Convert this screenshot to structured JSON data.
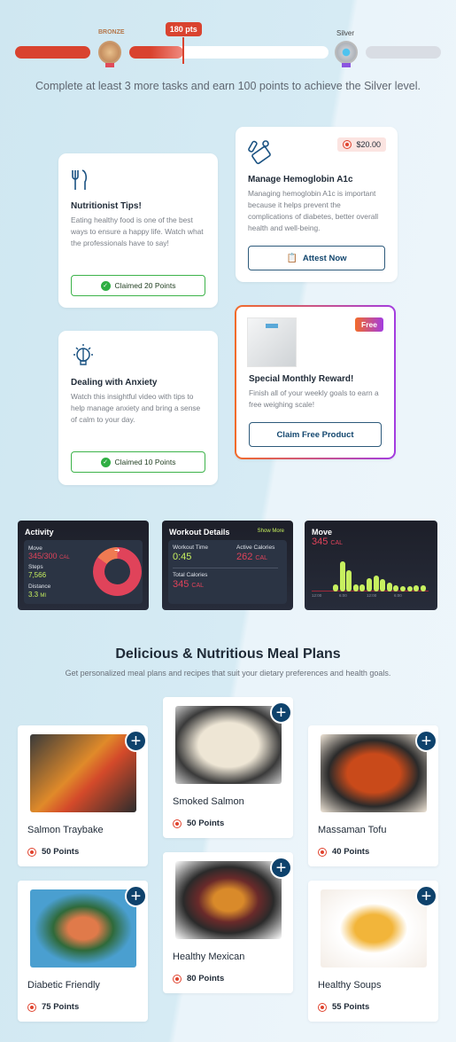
{
  "progress": {
    "current_points": "180 pts",
    "levels": [
      {
        "label": "BRONZE",
        "color": "#b5774b"
      },
      {
        "label": "Silver",
        "color": "#9aa0a8"
      }
    ],
    "fill_fraction": 0.27,
    "message": "Complete at least 3 more tasks and earn 100 points to achieve the Silver level.",
    "accent": "#d9432f"
  },
  "tasks": [
    {
      "icon": "fork-knife-icon",
      "title": "Nutritionist Tips!",
      "description": "Eating healthy food is one of the best ways to ensure a happy life. Watch what the professionals have to say!",
      "button": "Claimed 20 Points",
      "status": "claimed"
    },
    {
      "icon": "lab-test-icon",
      "badge": "$20.00",
      "title": "Manage Hemoglobin A1c",
      "description": "Managing hemoglobin A1c is important because it helps prevent the complications of diabetes, better overall health and well-being.",
      "button": "Attest Now"
    },
    {
      "icon": "brain-bulb-icon",
      "title": "Dealing with Anxiety",
      "description": "Watch this insightful video with tips to help manage anxiety and bring a sense of calm to your day.",
      "button": "Claimed 10 Points",
      "status": "claimed"
    },
    {
      "icon": "weighing-scale-image",
      "badge": "Free",
      "title": "Special Monthly Reward!",
      "description": "Finish all of your weekly goals to earn a free weighing scale!",
      "button": "Claim Free Product"
    }
  ],
  "activity": {
    "title": "Activity",
    "move_label": "Move",
    "move_value": "345/300",
    "move_unit": "CAL",
    "move_progress": 1.15,
    "steps_label": "Steps",
    "steps_value": "7,566",
    "distance_label": "Distance",
    "distance_value": "3.3",
    "distance_unit": "MI"
  },
  "workout": {
    "title": "Workout Details",
    "show_more": "Show More",
    "time_label": "Workout Time",
    "time_value": "0:45",
    "active_label": "Active Calories",
    "active_value": "262",
    "active_unit": "CAL",
    "total_label": "Total Calories",
    "total_value": "345",
    "total_unit": "CAL"
  },
  "move_chart": {
    "title": "Move",
    "value": "345",
    "unit": "CAL",
    "bars": [
      0.25,
      1,
      0.72,
      0.25,
      0.25,
      0.45,
      0.52,
      0.4,
      0.28,
      0.2,
      0.18,
      0.18,
      0.2,
      0.2
    ],
    "ticks": [
      "12:00",
      "6:00",
      "12:00",
      "6:00"
    ]
  },
  "meals": {
    "title": "Delicious & Nutritious Meal Plans",
    "subtitle": "Get personalized meal plans and recipes that suit your dietary preferences and health goals.",
    "items": [
      {
        "name": "Salmon Traybake",
        "points": "50 Points"
      },
      {
        "name": "Smoked Salmon",
        "points": "50 Points"
      },
      {
        "name": "Massaman Tofu",
        "points": "40 Points"
      },
      {
        "name": "Diabetic Friendly",
        "points": "75 Points"
      },
      {
        "name": "Healthy Mexican",
        "points": "80 Points"
      },
      {
        "name": "Healthy Soups",
        "points": "55 Points"
      }
    ],
    "add_label": "+"
  }
}
